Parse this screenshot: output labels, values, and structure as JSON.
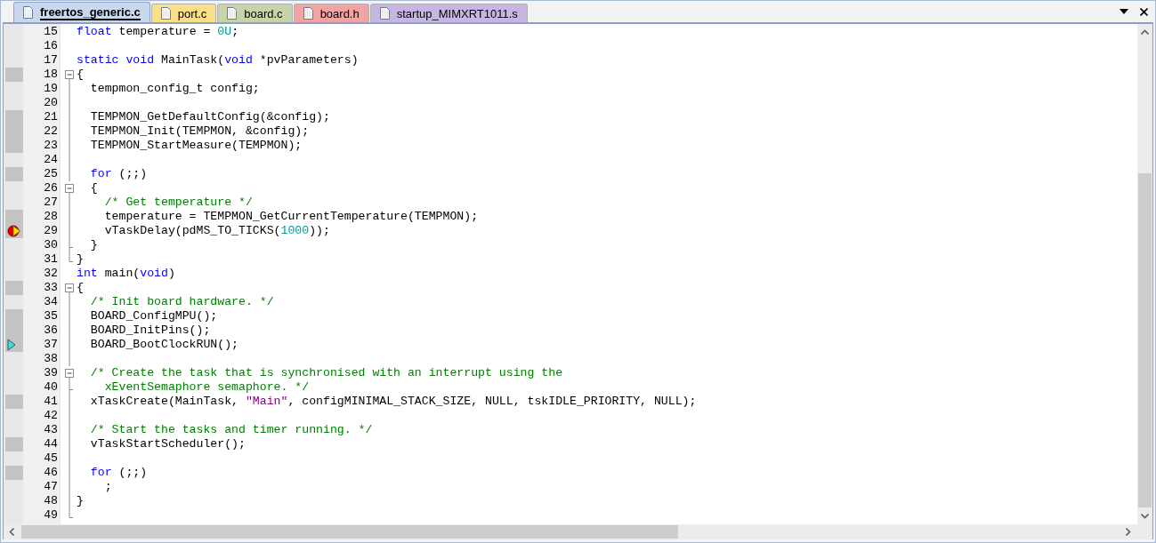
{
  "tabs": [
    {
      "label": "freertos_generic.c",
      "selected": true,
      "color": "#c9d8ef"
    },
    {
      "label": "port.c",
      "selected": false,
      "color": "#fbe08a"
    },
    {
      "label": "board.c",
      "selected": false,
      "color": "#c7d4a9"
    },
    {
      "label": "board.h",
      "selected": false,
      "color": "#f2a3a3"
    },
    {
      "label": "startup_MIMXRT1011.s",
      "selected": false,
      "color": "#c8b6e2"
    }
  ],
  "lines": [
    {
      "number": "15",
      "executable": false,
      "tokens": [
        {
          "kind": "kw",
          "text": "float"
        },
        {
          "kind": "plain",
          "text": " temperature = "
        },
        {
          "kind": "num",
          "text": "0U"
        },
        {
          "kind": "plain",
          "text": ";"
        }
      ]
    },
    {
      "number": "16",
      "executable": false
    },
    {
      "number": "17",
      "executable": false,
      "tokens": [
        {
          "kind": "kw",
          "text": "static void"
        },
        {
          "kind": "plain",
          "text": " MainTask("
        },
        {
          "kind": "kw",
          "text": "void"
        },
        {
          "kind": "plain",
          "text": " *pvParameters)"
        }
      ]
    },
    {
      "number": "18",
      "executable": true,
      "fold": {
        "kind": "open"
      },
      "tokens": [
        {
          "kind": "plain",
          "text": "{"
        }
      ]
    },
    {
      "number": "19",
      "executable": false,
      "fold": {
        "kind": "line"
      },
      "tokens": [
        {
          "kind": "plain",
          "text": "  tempmon_config_t config;"
        }
      ]
    },
    {
      "number": "20",
      "executable": false,
      "fold": {
        "kind": "line"
      }
    },
    {
      "number": "21",
      "executable": true,
      "fold": {
        "kind": "line"
      },
      "tokens": [
        {
          "kind": "plain",
          "text": "  TEMPMON_GetDefaultConfig(&config);"
        }
      ]
    },
    {
      "number": "22",
      "executable": true,
      "fold": {
        "kind": "line"
      },
      "tokens": [
        {
          "kind": "plain",
          "text": "  TEMPMON_Init(TEMPMON, &config);"
        }
      ]
    },
    {
      "number": "23",
      "executable": true,
      "fold": {
        "kind": "line"
      },
      "tokens": [
        {
          "kind": "plain",
          "text": "  TEMPMON_StartMeasure(TEMPMON);"
        }
      ]
    },
    {
      "number": "24",
      "executable": false,
      "fold": {
        "kind": "line"
      }
    },
    {
      "number": "25",
      "executable": true,
      "fold": {
        "kind": "line"
      },
      "tokens": [
        {
          "kind": "kw",
          "text": "  for"
        },
        {
          "kind": "plain",
          "text": " (;;)"
        }
      ]
    },
    {
      "number": "26",
      "executable": false,
      "fold": {
        "kind": "open"
      },
      "tokens": [
        {
          "kind": "plain",
          "text": "  {"
        }
      ]
    },
    {
      "number": "27",
      "executable": false,
      "fold": {
        "kind": "line"
      },
      "tokens": [
        {
          "kind": "comment",
          "text": "    /* Get temperature */"
        }
      ]
    },
    {
      "number": "28",
      "executable": true,
      "fold": {
        "kind": "line"
      },
      "tokens": [
        {
          "kind": "plain",
          "text": "    temperature = TEMPMON_GetCurrentTemperature(TEMPMON);"
        }
      ]
    },
    {
      "number": "29",
      "executable": true,
      "fold": {
        "kind": "line"
      },
      "marker": {
        "kind": "breakpoint-current"
      },
      "tokens": [
        {
          "kind": "plain",
          "text": "    vTaskDelay(pdMS_TO_TICKS("
        },
        {
          "kind": "num",
          "text": "1000"
        },
        {
          "kind": "plain",
          "text": "));"
        }
      ]
    },
    {
      "number": "30",
      "executable": false,
      "fold": {
        "kind": "tick"
      },
      "tokens": [
        {
          "kind": "plain",
          "text": "  }"
        }
      ]
    },
    {
      "number": "31",
      "executable": false,
      "fold": {
        "kind": "end"
      },
      "tokens": [
        {
          "kind": "plain",
          "text": "}"
        }
      ]
    },
    {
      "number": "32",
      "executable": false,
      "tokens": [
        {
          "kind": "kw",
          "text": "int"
        },
        {
          "kind": "plain",
          "text": " main("
        },
        {
          "kind": "kw",
          "text": "void"
        },
        {
          "kind": "plain",
          "text": ")"
        }
      ]
    },
    {
      "number": "33",
      "executable": true,
      "fold": {
        "kind": "open"
      },
      "tokens": [
        {
          "kind": "plain",
          "text": "{"
        }
      ]
    },
    {
      "number": "34",
      "executable": false,
      "fold": {
        "kind": "line"
      },
      "tokens": [
        {
          "kind": "comment",
          "text": "  /* Init board hardware. */"
        }
      ]
    },
    {
      "number": "35",
      "executable": true,
      "fold": {
        "kind": "line"
      },
      "tokens": [
        {
          "kind": "plain",
          "text": "  BOARD_ConfigMPU();"
        }
      ]
    },
    {
      "number": "36",
      "executable": true,
      "fold": {
        "kind": "line"
      },
      "tokens": [
        {
          "kind": "plain",
          "text": "  BOARD_InitPins();"
        }
      ]
    },
    {
      "number": "37",
      "executable": true,
      "fold": {
        "kind": "line"
      },
      "marker": {
        "kind": "current"
      },
      "tokens": [
        {
          "kind": "plain",
          "text": "  BOARD_BootClockRUN();"
        }
      ]
    },
    {
      "number": "38",
      "executable": false,
      "fold": {
        "kind": "line"
      }
    },
    {
      "number": "39",
      "executable": false,
      "fold": {
        "kind": "open"
      },
      "tokens": [
        {
          "kind": "comment",
          "text": "  /* Create the task that is synchronised with an interrupt using the"
        }
      ]
    },
    {
      "number": "40",
      "executable": false,
      "fold": {
        "kind": "tick"
      },
      "tokens": [
        {
          "kind": "comment",
          "text": "    xEventSemaphore semaphore. */"
        }
      ]
    },
    {
      "number": "41",
      "executable": true,
      "fold": {
        "kind": "line"
      },
      "tokens": [
        {
          "kind": "plain",
          "text": "  xTaskCreate(MainTask, "
        },
        {
          "kind": "str",
          "text": "\"Main\""
        },
        {
          "kind": "plain",
          "text": ", configMINIMAL_STACK_SIZE, NULL, tskIDLE_PRIORITY, NULL);"
        }
      ]
    },
    {
      "number": "42",
      "executable": false,
      "fold": {
        "kind": "line"
      }
    },
    {
      "number": "43",
      "executable": false,
      "fold": {
        "kind": "line"
      },
      "tokens": [
        {
          "kind": "comment",
          "text": "  /* Start the tasks and timer running. */"
        }
      ]
    },
    {
      "number": "44",
      "executable": true,
      "fold": {
        "kind": "line"
      },
      "tokens": [
        {
          "kind": "plain",
          "text": "  vTaskStartScheduler();"
        }
      ]
    },
    {
      "number": "45",
      "executable": false,
      "fold": {
        "kind": "line"
      }
    },
    {
      "number": "46",
      "executable": true,
      "fold": {
        "kind": "line"
      },
      "tokens": [
        {
          "kind": "kw",
          "text": "  for"
        },
        {
          "kind": "plain",
          "text": " (;;)"
        }
      ]
    },
    {
      "number": "47",
      "executable": false,
      "fold": {
        "kind": "line"
      },
      "tokens": [
        {
          "kind": "plain",
          "text": "    ;"
        }
      ]
    },
    {
      "number": "48",
      "executable": false,
      "fold": {
        "kind": "line"
      },
      "tokens": [
        {
          "kind": "plain",
          "text": "}"
        }
      ]
    },
    {
      "number": "49",
      "executable": false,
      "fold": {
        "kind": "end"
      }
    }
  ]
}
